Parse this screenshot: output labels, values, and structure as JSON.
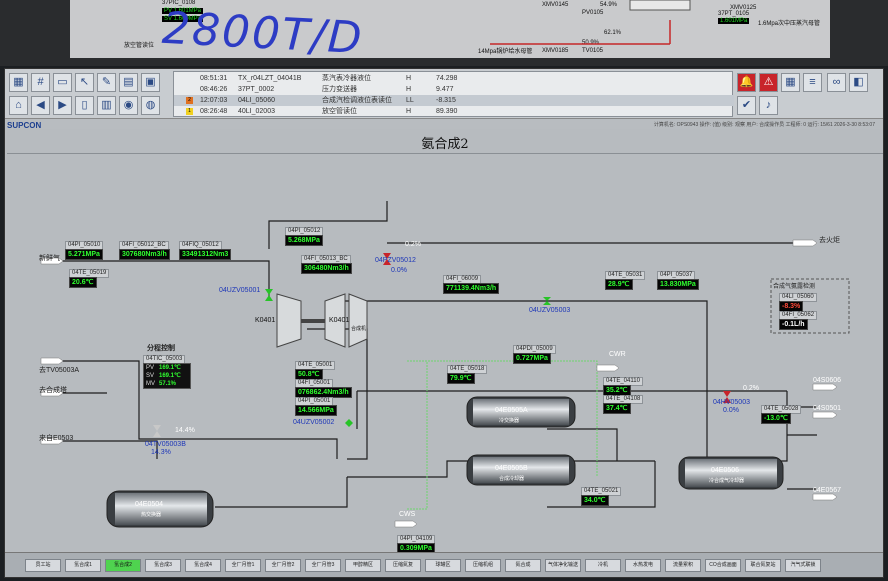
{
  "background": {
    "handwriting": "2800T/D",
    "top_labels": [
      {
        "text": "37PIC_0108"
      },
      {
        "text": "PV  1.601MPa"
      },
      {
        "text": "SV  1.600MPa"
      },
      {
        "text": "XMV0145"
      },
      {
        "text": "PV0105"
      },
      {
        "text": "54.9%"
      },
      {
        "text": "XMV0125"
      },
      {
        "text": "37PT_0105"
      },
      {
        "text": "1.601MPa"
      },
      {
        "text": "1.6Mpa次中压蒸汽母管"
      },
      {
        "text": "14Mpa锅炉给水母管"
      },
      {
        "text": "XMV0185"
      },
      {
        "text": "50.9%"
      },
      {
        "text": "TV0105"
      },
      {
        "text": "62.1%"
      },
      {
        "text": "放空管读位"
      }
    ]
  },
  "toolbar": {
    "alarms": [
      {
        "num": "",
        "time": "08:51:31",
        "tag": "TX_r04LZT_04041B",
        "desc": "蒸汽表冷器液位",
        "level": "H",
        "value": "74.298"
      },
      {
        "num": "",
        "time": "08:46:26",
        "tag": "37PT_0002",
        "desc": "压力变送器",
        "level": "H",
        "value": "9.477"
      },
      {
        "num": "2",
        "time": "12:07:03",
        "tag": "04LI_05060",
        "desc": "合成汽检调液位表读位",
        "level": "LL",
        "value": "-8.315"
      },
      {
        "num": "1",
        "time": "08:26:48",
        "tag": "40LI_02003",
        "desc": "放空管读位",
        "level": "H",
        "value": "89.390"
      }
    ],
    "logo": "SUPCON",
    "status": "计算机名: OPS0943  操作: (值)  级别: 观察  用户: 合成操作员  工程师: 0  运行: 15/61  2026-3-30 8:53:07"
  },
  "title": "氨合成2",
  "labels": {
    "fresh_gas": "新鲜气",
    "to_torch": "去火炬",
    "to_tv": "去TV05003A",
    "to_synth_tower": "去合成塔",
    "from_e0503": "来自E0503",
    "split_control": "分程控制",
    "cwr": "CWR",
    "cws": "CWS",
    "s0606": "04S0606",
    "s0501": "04S0501",
    "e0567": "04E0567",
    "syngas_detect": "合成气氨露检测"
  },
  "instruments": {
    "pi05010_tag": "04PI_05010",
    "pi05010_val": "5.271MPa",
    "fi05012_tag": "04FI_05012_BC",
    "fi05012_val": "307680Nm3/h",
    "fiq05012_tag": "04FIQ_05012",
    "fiq05012_val": "33491312Nm3",
    "pi05012_tag": "04PI_05012",
    "pi05012_val": "5.268MPa",
    "fi05013_tag": "04FI_05013_BC",
    "fi05013_val": "306480Nm3/h",
    "te05019_tag": "04TE_05019",
    "te05019_val": "20.6℃",
    "fi06009_tag": "04FI_06009",
    "fi06009_val": "771139.4Nm3/h",
    "te05031_tag": "04TE_05031",
    "te05031_val": "28.9℃",
    "pi05037_tag": "04PI_05037",
    "pi05037_val": "13.830MPa",
    "ai05060_tag": "04LI_05060",
    "ai05060_val": "-8.3%",
    "fi05062_tag": "04FI_05062",
    "fi05062_val": "-0.1L/h",
    "te05001_tag": "04TE_05001",
    "te05001_val": "50.8℃",
    "fi05001_tag": "04FI_05001",
    "fi05001_val": "076862.4Nm3/h",
    "pi05001_tag": "04PI_05001",
    "pi05001_val": "14.566MPa",
    "pdi05009_tag": "04PDI_05009",
    "pdi05009_val": "0.727MPa",
    "te05018_tag": "04TE_05018",
    "te05018_val": "79.9℃",
    "te04110_tag": "04TE_04110",
    "te04110_val": "35.2℃",
    "te04108_tag": "04TE_04108",
    "te04108_val": "37.4℃",
    "te05028_tag": "04TE_05028",
    "te05028_val": "-13.0℃",
    "te05021_tag": "04TE_05021",
    "te05021_val": "34.0℃",
    "pi04109_tag": "04PI_04109",
    "pi04109_val": "0.309MPa"
  },
  "control": {
    "tic_tag": "04TIC_05003",
    "pv_key": "PV",
    "pv": "169.1℃",
    "sv_key": "SV",
    "sv": "169.1℃",
    "mv_key": "MV",
    "mv": "57.1%"
  },
  "valves": {
    "pzv05012": "04PZV05012",
    "pzv05012_pct": "0.0%",
    "pzv05012_open": "0.2%",
    "uzv05001": "04UZV05001",
    "uzv05002": "04UZV05002",
    "uzv05003": "04UZV05003",
    "tv05003b": "04TV05003B",
    "tv05003b_pct": "14.3%",
    "tv05003b_open": "14.4%",
    "hv05003": "04HV05003",
    "hv05003_pct": "0.0%",
    "hv05003_open": "0.2%"
  },
  "equipment": {
    "k0401a": "K0401",
    "k0401b": "K0401",
    "k0401b_sub": "合成机",
    "e0505a": "04E0505A",
    "e0505a_sub": "冷交换器",
    "e0505b": "04E0505B",
    "e0505b_sub": "合成冷却器",
    "e0506": "04E0506",
    "e0506_sub": "冷合成气冷却器",
    "e0504": "04E0504",
    "e0504_sub": "热交换器"
  },
  "nav": [
    "员工站",
    "氢合成1",
    "氢合成2",
    "氢合成3",
    "氢合成4",
    "全厂月管1",
    "全厂月管2",
    "全厂月管3",
    "甲醇精区",
    "压缩氮复",
    "球罐区",
    "压缩机组",
    "氮合成",
    "气体净化输送",
    "冷机",
    "水热发电",
    "流量累积",
    "CO合成画面",
    "联合氮复站",
    "汽气式联锁"
  ],
  "colors": {
    "value_green": "#2fff2f",
    "alarm_red": "#c8242a",
    "valve_green": "#27c427",
    "pipe": "#1e1e1e"
  }
}
